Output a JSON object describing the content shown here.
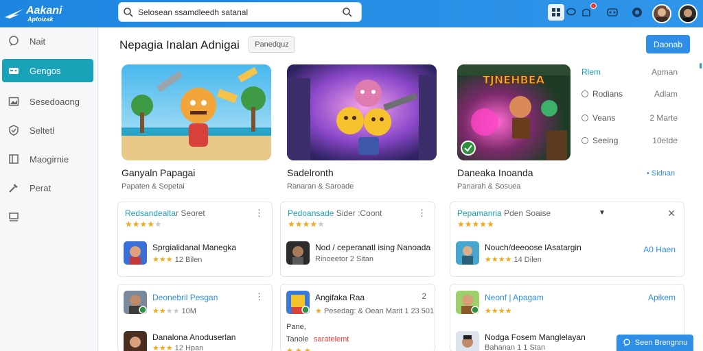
{
  "app": {
    "name": "Aakani",
    "tagline": "Aptoizak"
  },
  "search": {
    "value": "Selosean ssamdleedh satanal"
  },
  "sidebar": {
    "items": [
      {
        "label": "Nait",
        "icon": "chat-bubble-icon"
      },
      {
        "label": "Gengos",
        "icon": "controller-icon",
        "active": true
      },
      {
        "label": "Sesedoaong",
        "icon": "image-icon"
      },
      {
        "label": "Seltetl",
        "icon": "shield-icon"
      },
      {
        "label": "Maogirnie",
        "icon": "book-icon"
      },
      {
        "label": "Perat",
        "icon": "tools-icon"
      },
      {
        "label": "",
        "icon": "screen-icon"
      }
    ]
  },
  "main": {
    "title": "Nepagia Inalan Adnigai",
    "filter_chip": "Panedquz",
    "primary_button": "Daonab",
    "features": [
      {
        "title": "Ganyaln Papagai",
        "subtitle": "Papaten & Sopetai"
      },
      {
        "title": "Sadelronth",
        "subtitle": "Ranaran & Saroade"
      },
      {
        "title": "Daneaka Inoanda",
        "subtitle": "Panarah & Sosuea",
        "banner": "TJNEHBEA"
      }
    ],
    "ranking": {
      "header_left": "Rlem",
      "header_right": "Apman",
      "rows": [
        {
          "label": "Rodians",
          "value": "Adlam"
        },
        {
          "label": "Veans",
          "value": "2 Marte"
        },
        {
          "label": "Seeing",
          "value": "10etde"
        }
      ],
      "see_all": "• Sidnan"
    },
    "cards_row1": [
      {
        "title": "Redsandealta",
        "title2": "r Seoret",
        "stars": 4,
        "name": "Sprgialidanal Manegka",
        "meta": "12 Bilen",
        "meta_stars": 3
      },
      {
        "title": "Pedoansade",
        "title2": "Sider :Coont",
        "stars": 4,
        "name": "Nod / ceperanatl ising Nanoada",
        "meta": "Rinoeetor 2 Sitan"
      },
      {
        "title": "Pepamanria",
        "title2": "Pden Soaise",
        "stars": 5,
        "name": "Nouch/deeoose lAsatargin",
        "meta": "14 Dilen",
        "meta_stars": 4,
        "action": "A0 Haen"
      }
    ],
    "cards_row2": [
      {
        "title": "Deonebril Pesgan",
        "meta": "10M",
        "meta_stars": 2,
        "name": "Danalona Anoduserlan",
        "sub": "12 Hpan"
      },
      {
        "title": "Angifaka Raa",
        "meta": "Pesedag: & Oean Marit 1 23 501",
        "lines": [
          "Pane,",
          "Tanole"
        ],
        "red": "saratelemt"
      },
      {
        "title": "Neonf | Apagam",
        "action": "Apikem",
        "meta_stars": 4,
        "name": "Nodga Fosem Manglelayan",
        "sub": "Bahanan 1 1 Stan"
      }
    ]
  },
  "chat_button": "Seen Brengnnu",
  "colors": {
    "topbar": "#1d86e0",
    "accent": "#1aa3b8",
    "primary": "#2f8ee5",
    "star": "#f2a516"
  }
}
